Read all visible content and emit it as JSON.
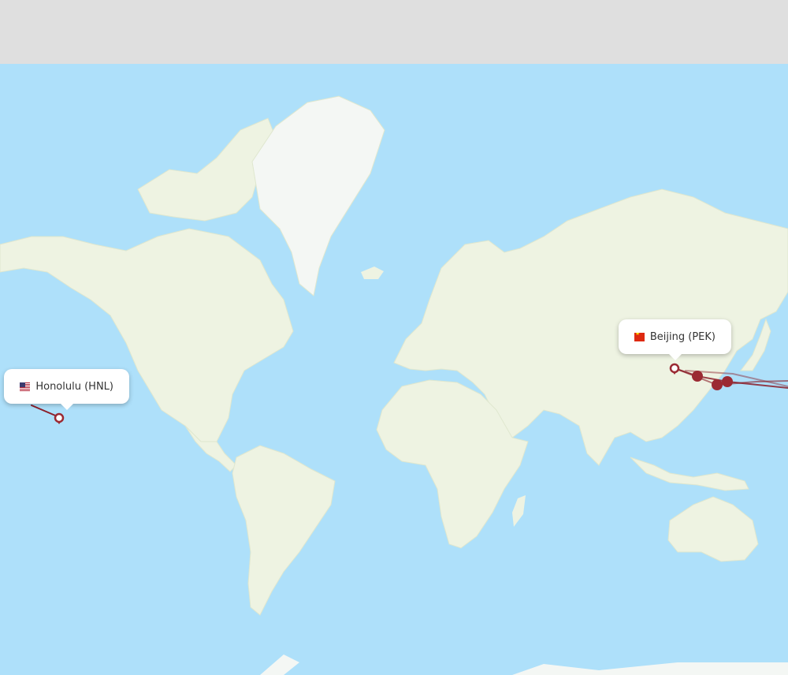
{
  "origin": {
    "city_label": "Honolulu (HNL)",
    "flag_icon": "us-flag-icon",
    "country": "United States"
  },
  "destination": {
    "city_label": "Beijing (PEK)",
    "flag_icon": "china-flag-icon",
    "country": "China"
  },
  "colors": {
    "ocean": "#aee0fa",
    "land": "#eef3e2",
    "ice": "#f4f7f4",
    "route": "#8b1f2a",
    "route_marker": "#9b2a33",
    "header": "#dfdfdf"
  }
}
